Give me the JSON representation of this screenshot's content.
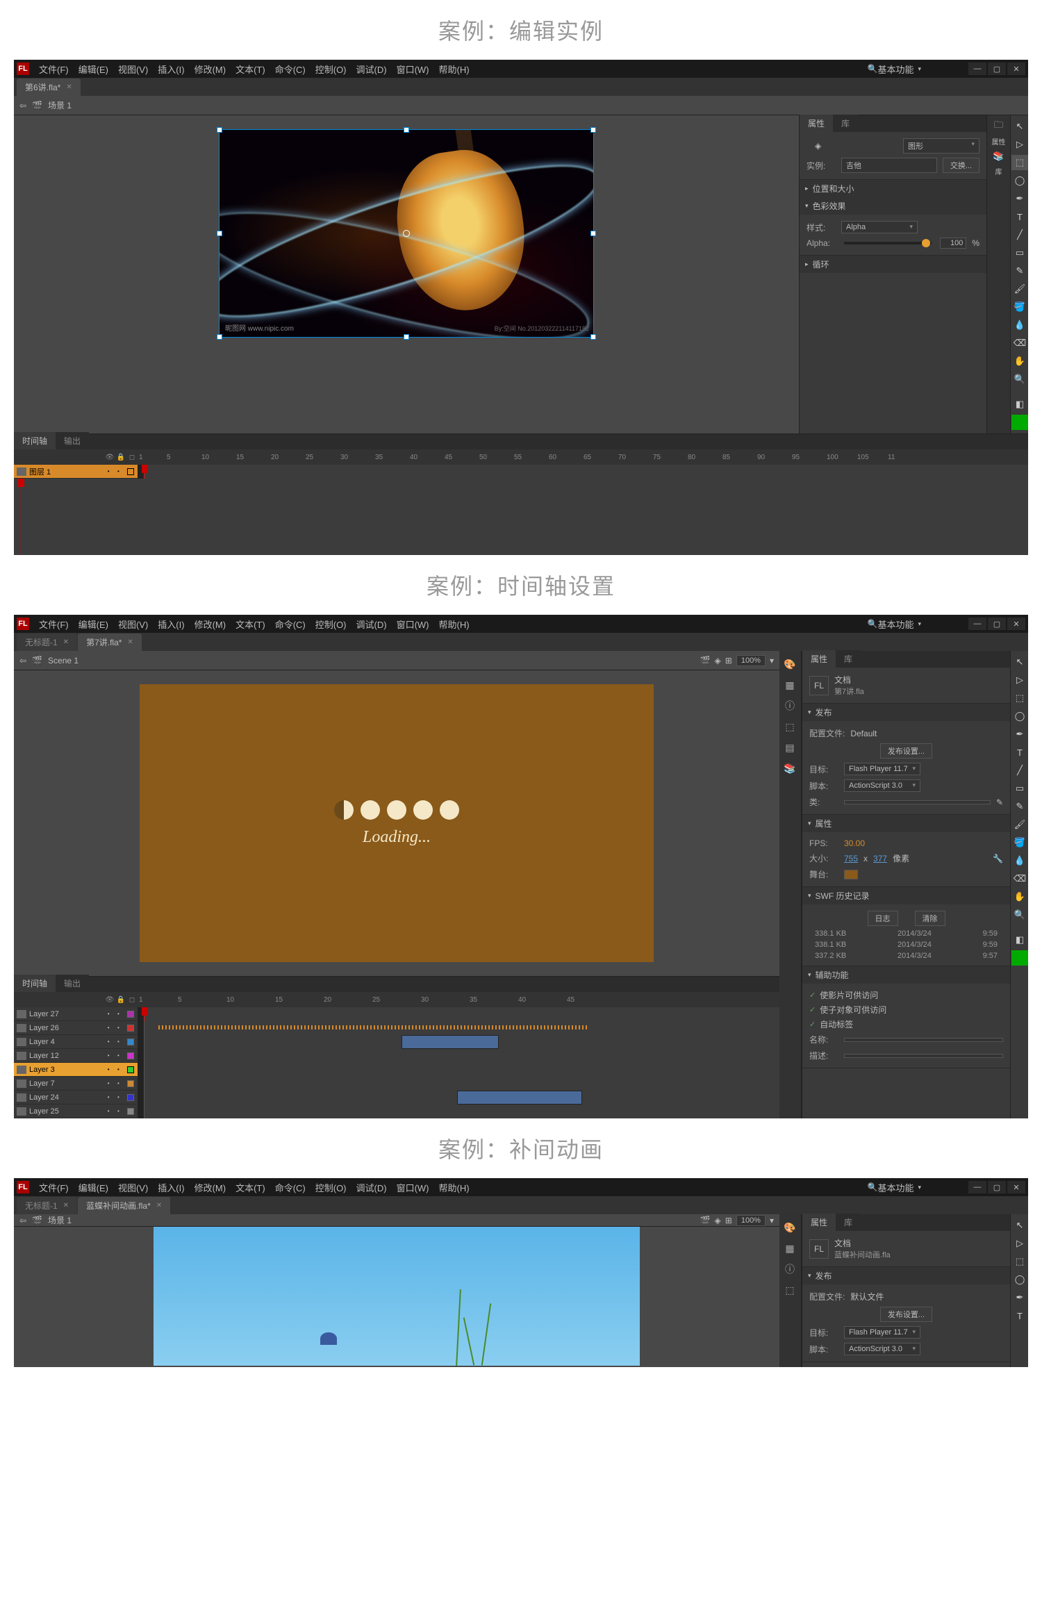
{
  "captions": {
    "c1": "案例：编辑实例",
    "c2": "案例：时间轴设置",
    "c3": "案例：补间动画"
  },
  "menus": [
    "文件(F)",
    "编辑(E)",
    "视图(V)",
    "插入(I)",
    "修改(M)",
    "文本(T)",
    "命令(C)",
    "控制(O)",
    "调试(D)",
    "窗口(W)",
    "帮助(H)"
  ],
  "workspace": "基本功能",
  "app1": {
    "tab": "第6讲.fla*",
    "scene_label": "场景 1",
    "props_tab": "属性",
    "lib_tab": "库",
    "instance_label": "实例:",
    "instance_value": "吉他",
    "swap_btn": "交换...",
    "type_sel": "图形",
    "sec_pos": "位置和大小",
    "sec_color": "色彩效果",
    "sec_loop": "循环",
    "style_label": "样式:",
    "style_value": "Alpha",
    "alpha_label": "Alpha:",
    "alpha_value": "100",
    "alpha_unit": "%",
    "timeline_tab": "时间轴",
    "output_tab": "输出",
    "layer1": "图层 1",
    "side_tab1": "属性",
    "side_tab2": "库",
    "wm": "昵图网 www.nipic.com",
    "wm2": "By:空间 No.201203222114117182"
  },
  "app2": {
    "tab1": "无标题-1",
    "tab2": "第7讲.fla*",
    "scene_label": "Scene 1",
    "zoom": "100%",
    "loading": "Loading...",
    "doc_label": "文档",
    "doc_name": "第7讲.fla",
    "sec_publish": "发布",
    "profile_label": "配置文件:",
    "profile_value": "Default",
    "publish_btn": "发布设置...",
    "target_label": "目标:",
    "target_value": "Flash Player 11.7",
    "script_label": "脚本:",
    "script_value": "ActionScript 3.0",
    "class_label": "类:",
    "sec_props": "属性",
    "fps_label": "FPS:",
    "fps_value": "30.00",
    "size_label": "大小:",
    "size_w": "755",
    "size_x": "x",
    "size_h": "377",
    "size_unit": "像素",
    "stage_label": "舞台:",
    "sec_swf": "SWF 历史记录",
    "log_btn": "日志",
    "clear_btn": "清除",
    "hist": [
      {
        "size": "338.1 KB",
        "date": "2014/3/24",
        "time": "9:59"
      },
      {
        "size": "338.1 KB",
        "date": "2014/3/24",
        "time": "9:59"
      },
      {
        "size": "337.2 KB",
        "date": "2014/3/24",
        "time": "9:57"
      }
    ],
    "sec_access": "辅助功能",
    "acc1": "使影片可供访问",
    "acc2": "使子对象可供访问",
    "acc3": "自动标签",
    "name_label": "名称:",
    "desc_label": "描述:",
    "layers": [
      "Layer 27",
      "Layer 26",
      "Layer 4",
      "Layer 12",
      "Layer 3",
      "Layer 7",
      "Layer 24",
      "Layer 25"
    ],
    "ruler": [
      "1",
      "5",
      "10",
      "15",
      "20",
      "25",
      "30",
      "35",
      "40",
      "45"
    ]
  },
  "app3": {
    "tab1": "无标题-1",
    "tab2": "蓝蝶补间动画.fla*",
    "scene_label": "场景 1",
    "zoom": "100%",
    "doc_label": "文档",
    "doc_name": "蓝蝶补间动画.fla",
    "sec_publish": "发布",
    "profile_label": "配置文件:",
    "profile_value": "默认文件",
    "publish_btn": "发布设置...",
    "target_label": "目标:",
    "target_value": "Flash Player 11.7",
    "script_label": "脚本:",
    "script_value": "ActionScript 3.0"
  }
}
